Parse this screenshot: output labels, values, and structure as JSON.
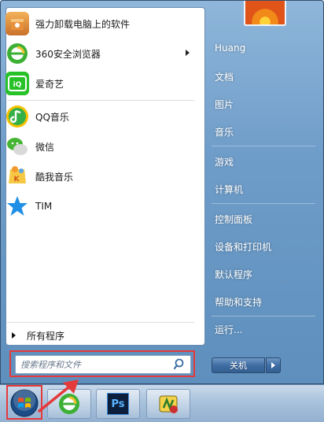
{
  "left_pane": {
    "programs": [
      {
        "label": "强力卸载电脑上的软件",
        "icon": "uninstall-box-icon",
        "submenu": false
      },
      {
        "label": "360安全浏览器",
        "icon": "360-browser-icon",
        "submenu": true
      },
      {
        "label": "爱奇艺",
        "icon": "iqiyi-icon",
        "submenu": false
      },
      {
        "label": "QQ音乐",
        "icon": "qq-music-icon",
        "submenu": false
      },
      {
        "label": "微信",
        "icon": "wechat-icon",
        "submenu": false
      },
      {
        "label": "酷我音乐",
        "icon": "kuwo-music-icon",
        "submenu": false
      },
      {
        "label": "TIM",
        "icon": "tim-icon",
        "submenu": false
      }
    ],
    "all_programs": "所有程序"
  },
  "search": {
    "placeholder": "搜索程序和文件",
    "value": ""
  },
  "right_pane": {
    "user_name": "Huang",
    "items": [
      "文档",
      "图片",
      "音乐",
      "游戏",
      "计算机",
      "控制面板",
      "设备和打印机",
      "默认程序",
      "帮助和支持",
      "运行..."
    ]
  },
  "shutdown": {
    "label": "关机"
  },
  "taskbar": {
    "buttons": [
      "start-orb",
      "360-browser-icon",
      "photoshop-icon",
      "ftp-tool-icon"
    ],
    "ps_text": "Ps"
  },
  "colors": {
    "highlight_red": "#e43a3a",
    "menu_blue": "#6f9dc9"
  }
}
